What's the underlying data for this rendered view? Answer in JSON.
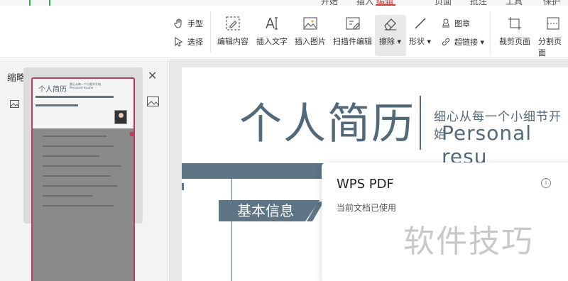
{
  "menubar": {
    "items": [
      "开始",
      "插入",
      "编辑",
      "页面",
      "批注",
      "工具",
      "保护"
    ],
    "active": "编辑"
  },
  "ribbon": {
    "hand_tool": "手型",
    "select_tool": "选择",
    "edit_content": "编辑内容",
    "insert_text": "插入文字",
    "insert_image": "插入图片",
    "scan_edit": "扫描件编辑",
    "erase": "擦除",
    "shape": "形状",
    "stamp": "图章",
    "hyperlink": "超链接",
    "crop_page": "裁剪页面",
    "split_page": "分割页面"
  },
  "thumbnails": {
    "title": "缩略图",
    "zoom_level": 0.14,
    "page": {
      "title": "个人简历",
      "subtitle_cn": "细心从每一个小细节开始",
      "subtitle_en": "Personal resume"
    }
  },
  "document": {
    "title": "个人简历",
    "subtitle_cn": "细心从每一个小细节开始",
    "subtitle_en": "Personal resu",
    "section": "基本信息"
  },
  "popup": {
    "title": "WPS PDF",
    "status": "当前文档已使用",
    "info_icon": "i"
  },
  "watermark": "软件技巧",
  "colors": {
    "accent_red": "#d23c3c",
    "doc_slate": "#52697a",
    "highlight_green": "#2bb24c",
    "thumb_border": "#c23a5e"
  }
}
